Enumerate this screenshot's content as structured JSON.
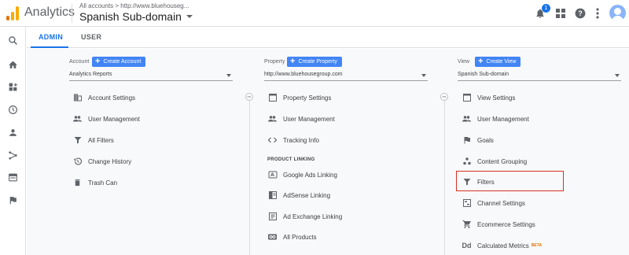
{
  "header": {
    "app_name": "Analytics",
    "breadcrumb": "All accounts > http://www.bluehouseg...",
    "property_title": "Spanish Sub-domain",
    "notification_count": "1"
  },
  "tabs": {
    "admin": "ADMIN",
    "user": "USER"
  },
  "account": {
    "label": "Account",
    "create_label": "Create Account",
    "selected": "Analytics Reports",
    "items": [
      "Account Settings",
      "User Management",
      "All Filters",
      "Change History",
      "Trash Can"
    ]
  },
  "property": {
    "label": "Property",
    "create_label": "Create Property",
    "selected": "http://www.bluehousegroup.com",
    "items": [
      "Property Settings",
      "User Management",
      "Tracking Info"
    ],
    "section_heading": "PRODUCT LINKING",
    "linking_items": [
      "Google Ads Linking",
      "AdSense Linking",
      "Ad Exchange Linking",
      "All Products"
    ]
  },
  "view": {
    "label": "View",
    "create_label": "Create View",
    "selected": "Spanish Sub-domain",
    "items": [
      "View Settings",
      "User Management",
      "Goals",
      "Content Grouping",
      "Filters",
      "Channel Settings",
      "Ecommerce Settings",
      "Calculated Metrics"
    ],
    "beta_label": "BETA"
  },
  "colors": {
    "accent": "#1a73e8",
    "button": "#4285f4",
    "highlight": "#d93025"
  }
}
